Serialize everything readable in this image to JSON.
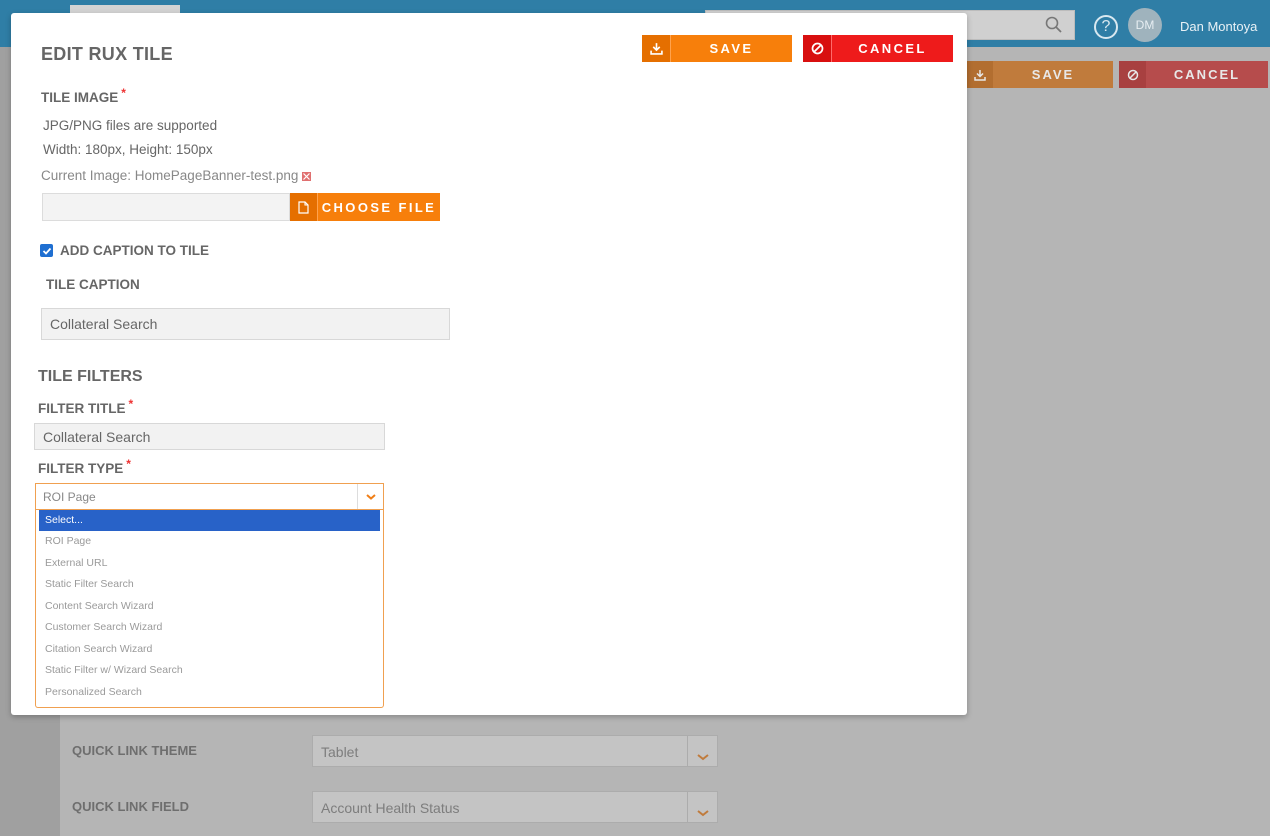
{
  "background": {
    "user_name": "Dan Montoya",
    "avatar_initials": "DM",
    "help_glyph": "?",
    "save_label": "SAVE",
    "cancel_label": "CANCEL",
    "quick_link_theme_label": "QUICK LINK THEME",
    "quick_link_theme_value": "Tablet",
    "quick_link_field_label": "QUICK LINK FIELD",
    "quick_link_field_value": "Account Health Status"
  },
  "modal": {
    "title": "EDIT RUX TILE",
    "save_label": "SAVE",
    "cancel_label": "CANCEL",
    "tile_image": {
      "label": "TILE IMAGE",
      "required_mark": "*",
      "help_line_1": "JPG/PNG files are supported",
      "help_line_2": "Width: 180px, Height: 150px",
      "current_image": "Current Image: HomePageBanner-test.png",
      "choose_file_label": "CHOOSE FILE"
    },
    "caption": {
      "checkbox_label": "ADD CAPTION TO TILE",
      "checked": true,
      "field_label": "TILE CAPTION",
      "value": "Collateral Search"
    },
    "filters": {
      "section_title": "TILE FILTERS",
      "filter_title_label": "FILTER TITLE",
      "filter_title_value": "Collateral Search",
      "filter_type_label": "FILTER TYPE",
      "required_mark": "*",
      "filter_type_value": "ROI Page",
      "options": [
        "Select...",
        "ROI Page",
        "External URL",
        "Static Filter Search",
        "Content Search Wizard",
        "Customer Search Wizard",
        "Citation Search Wizard",
        "Static Filter w/ Wizard Search",
        "Personalized Search"
      ],
      "highlighted_option": "Select..."
    }
  },
  "colors": {
    "accent_orange": "#f77f0b",
    "cancel_red": "#ee1b1b",
    "topbar_blue": "#2f7ea6",
    "highlight_blue": "#2862c8"
  }
}
